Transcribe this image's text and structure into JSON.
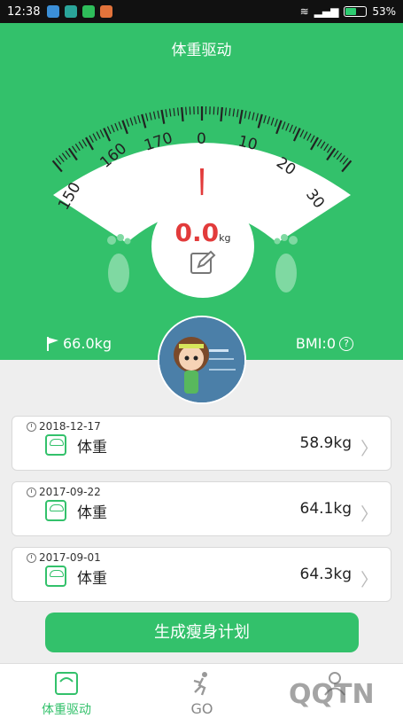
{
  "status_bar": {
    "time": "12:38",
    "battery": "53%",
    "battery_level": 0.53
  },
  "header": {
    "title": "体重驱动",
    "scale_ticks": [
      "150",
      "160",
      "170",
      "0",
      "10",
      "20",
      "30"
    ],
    "reading_value": "0.0",
    "reading_unit": "kg",
    "goal_weight": "66.0kg",
    "bmi": "BMI:0",
    "help_glyph": "?"
  },
  "records": [
    {
      "date": "2018-12-17",
      "label": "体重",
      "value": "58.9kg"
    },
    {
      "date": "2017-09-22",
      "label": "体重",
      "value": "64.1kg"
    },
    {
      "date": "2017-09-01",
      "label": "体重",
      "value": "64.3kg"
    }
  ],
  "plan_button": "生成瘦身计划",
  "nav": {
    "weight_label": "体重驱动",
    "go_label": "GO"
  },
  "watermark": "QQTN",
  "colors": {
    "brand_green": "#33c16b",
    "reading_red": "#e23b3b"
  },
  "icons": [
    "flag-icon",
    "edit-icon",
    "foot-icon",
    "clock-icon",
    "scale-icon",
    "chevron-right-icon",
    "running-icon",
    "person-icon",
    "help-icon"
  ]
}
